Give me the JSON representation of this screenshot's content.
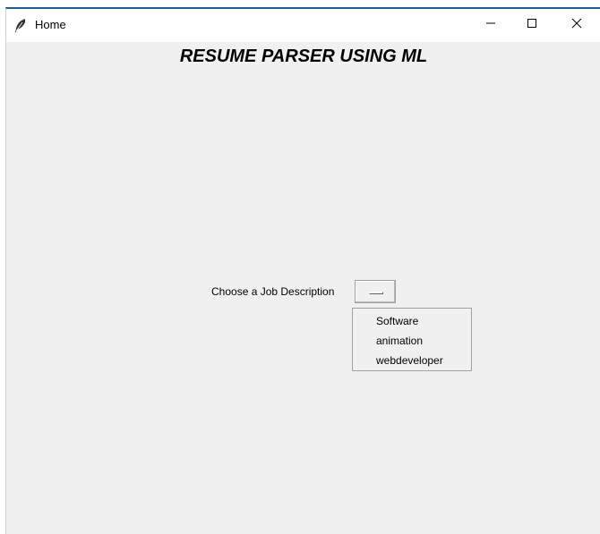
{
  "window": {
    "title": "Home",
    "icon": "feather-icon",
    "controls": [
      "minimize-icon",
      "maximize-icon",
      "close-icon"
    ]
  },
  "main": {
    "heading": "RESUME PARSER USING ML",
    "job_label": "Choose a Job Description",
    "job_options": [
      "Software",
      "animation",
      "webdeveloper"
    ]
  },
  "colors": {
    "window_bg": "#f0f0f0",
    "titlebar_bg": "#ffffff",
    "accent_border": "#1f5a96"
  }
}
